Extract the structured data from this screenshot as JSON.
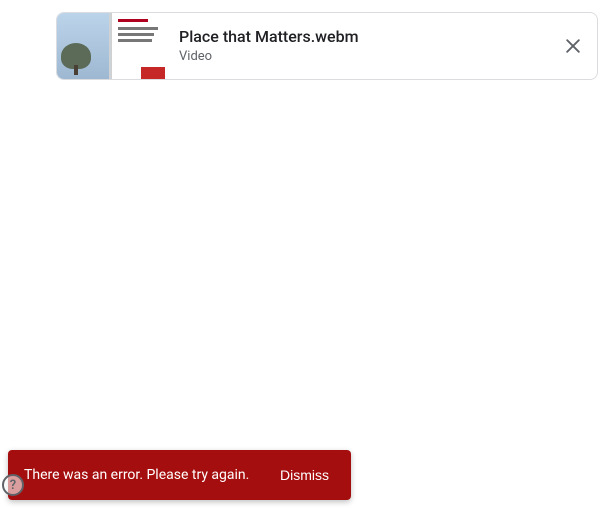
{
  "file_card": {
    "title": "Place that Matters.webm",
    "type_label": "Video"
  },
  "toast": {
    "message": "There was an error. Please try again.",
    "dismiss_label": "Dismiss"
  },
  "help": {
    "glyph": "?"
  }
}
